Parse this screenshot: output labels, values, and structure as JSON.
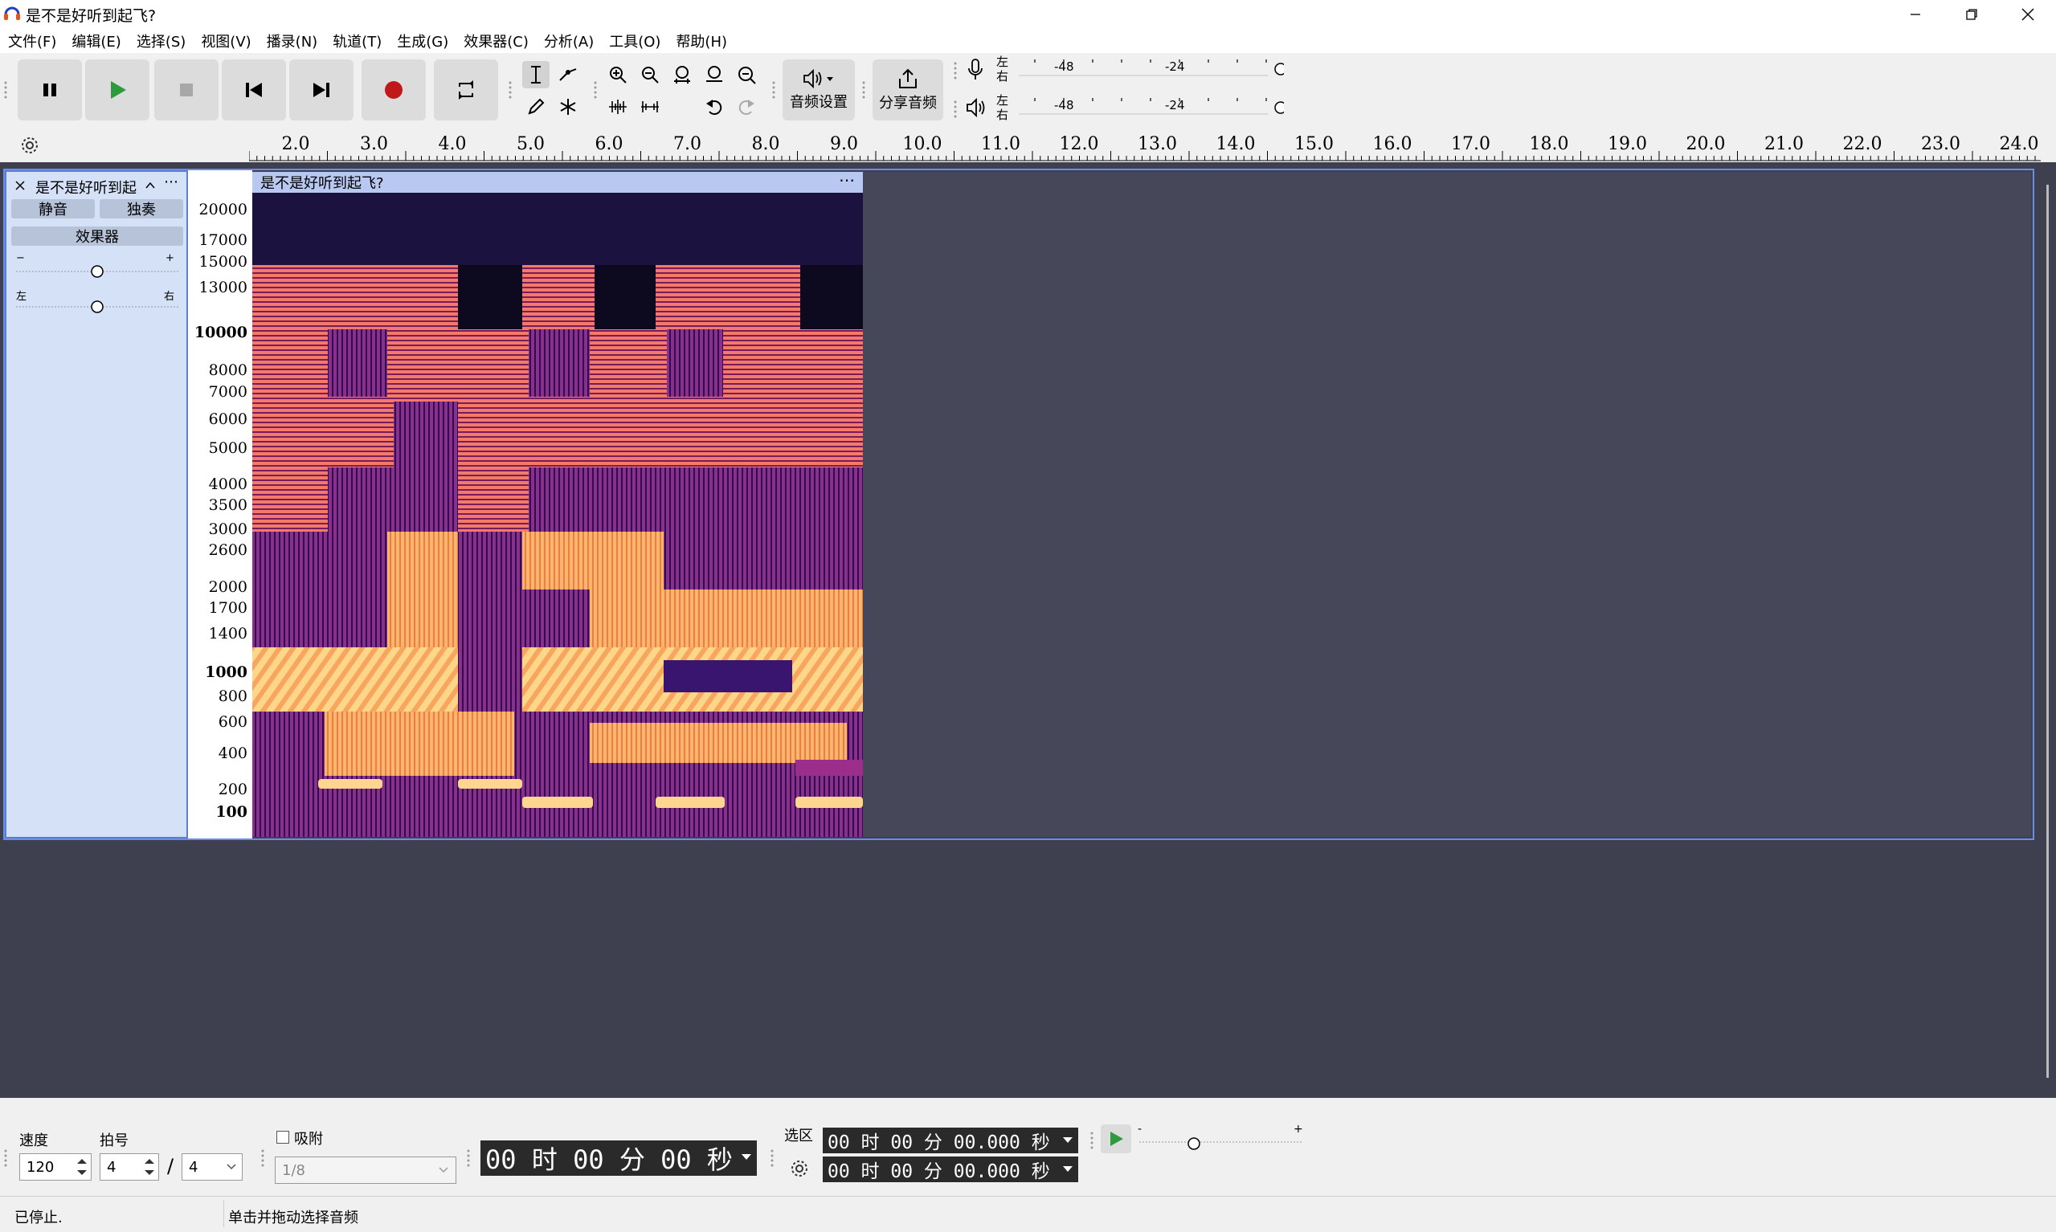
{
  "window": {
    "title": "是不是好听到起飞?"
  },
  "menu": [
    "文件(F)",
    "编辑(E)",
    "选择(S)",
    "视图(V)",
    "播录(N)",
    "轨道(T)",
    "生成(G)",
    "效果器(C)",
    "分析(A)",
    "工具(O)",
    "帮助(H)"
  ],
  "toolbar": {
    "audio_settings_label": "音频设置",
    "share_audio_label": "分享音频",
    "meter_left": "左",
    "meter_right": "右",
    "meter_ticks": [
      "-48",
      "-24"
    ]
  },
  "ruler": {
    "ticks": [
      "2.0",
      "3.0",
      "4.0",
      "5.0",
      "6.0",
      "7.0",
      "8.0",
      "9.0",
      "10.0",
      "11.0",
      "12.0",
      "13.0",
      "14.0",
      "15.0",
      "16.0",
      "17.0",
      "18.0",
      "19.0",
      "20.0",
      "21.0",
      "22.0",
      "23.0",
      "24.0"
    ]
  },
  "track": {
    "name": "是不是好听到起",
    "mute_label": "静音",
    "solo_label": "独奏",
    "effects_label": "效果器",
    "gain_minus": "−",
    "gain_plus": "+",
    "pan_left": "左",
    "pan_right": "右",
    "clip_name": "是不是好听到起飞?",
    "freq_labels": [
      {
        "text": "20000",
        "bold": false
      },
      {
        "text": "17000",
        "bold": false
      },
      {
        "text": "15000",
        "bold": false
      },
      {
        "text": "13000",
        "bold": false
      },
      {
        "text": "10000",
        "bold": true
      },
      {
        "text": "8000",
        "bold": false
      },
      {
        "text": "7000",
        "bold": false
      },
      {
        "text": "6000",
        "bold": false
      },
      {
        "text": "5000",
        "bold": false
      },
      {
        "text": "4000",
        "bold": false
      },
      {
        "text": "3500",
        "bold": false
      },
      {
        "text": "3000",
        "bold": false
      },
      {
        "text": "2600",
        "bold": false
      },
      {
        "text": "2000",
        "bold": false
      },
      {
        "text": "1700",
        "bold": false
      },
      {
        "text": "1400",
        "bold": false
      },
      {
        "text": "1000",
        "bold": true
      },
      {
        "text": "800",
        "bold": false
      },
      {
        "text": "600",
        "bold": false
      },
      {
        "text": "400",
        "bold": false
      },
      {
        "text": "200",
        "bold": false
      },
      {
        "text": "100",
        "bold": true
      }
    ]
  },
  "bottom": {
    "tempo_label": "速度",
    "tempo_value": "120",
    "timesig_label": "拍号",
    "timesig_num": "4",
    "timesig_sep": "/",
    "timesig_den": "4",
    "snap_label": "吸附",
    "snap_value": "1/8",
    "time_display": "00 时 00 分 00 秒",
    "selection_label": "选区",
    "sel_start": "00 时 00 分 00.000 秒",
    "sel_end": "00 时 00 分 00.000 秒",
    "speed_minus": "-",
    "speed_plus": "+"
  },
  "status": {
    "state": "已停止.",
    "hint": "单击并拖动选择音频"
  },
  "colors": {
    "accent_play": "#2e9a3e",
    "record": "#c01818",
    "track_bg": "#d4e1f7",
    "selected_border": "#5a7dd8"
  }
}
